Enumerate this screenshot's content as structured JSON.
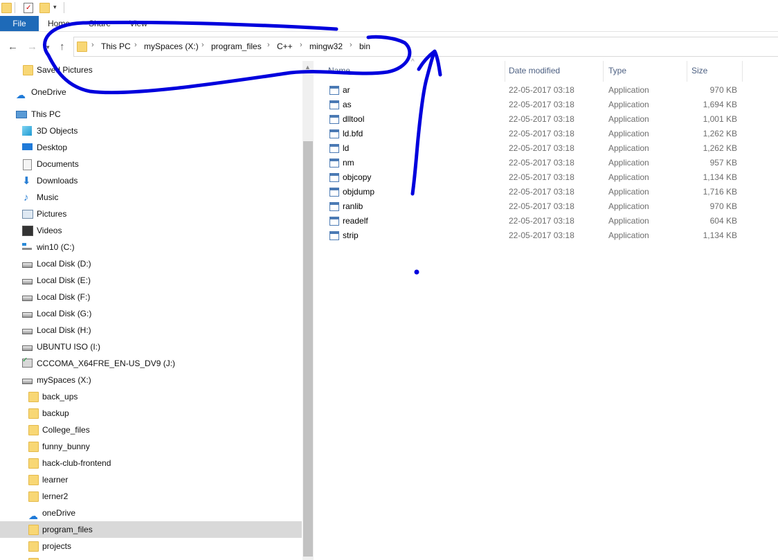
{
  "ribbon": {
    "file": "File",
    "home": "Home",
    "share": "Share",
    "view": "View"
  },
  "address": {
    "crumbs": [
      "This PC",
      "mySpaces (X:)",
      "program_files",
      "C++",
      "mingw32",
      "bin"
    ]
  },
  "nav_pane": {
    "items": [
      {
        "label": "Saved Pictures",
        "icon": "folder-icon"
      },
      {
        "label": "OneDrive",
        "icon": "cloud-icon"
      },
      {
        "label": "This PC",
        "icon": "computer-icon"
      },
      {
        "label": "3D Objects",
        "icon": "cube-icon"
      },
      {
        "label": "Desktop",
        "icon": "desktop-icon"
      },
      {
        "label": "Documents",
        "icon": "documents-icon"
      },
      {
        "label": "Downloads",
        "icon": "download-icon"
      },
      {
        "label": "Music",
        "icon": "music-icon"
      },
      {
        "label": "Pictures",
        "icon": "pictures-icon"
      },
      {
        "label": "Videos",
        "icon": "videos-icon"
      },
      {
        "label": "win10 (C:)",
        "icon": "windows-drive-icon"
      },
      {
        "label": "Local Disk (D:)",
        "icon": "drive-icon"
      },
      {
        "label": "Local Disk (E:)",
        "icon": "drive-icon"
      },
      {
        "label": "Local Disk (F:)",
        "icon": "drive-icon"
      },
      {
        "label": "Local Disk (G:)",
        "icon": "drive-icon"
      },
      {
        "label": "Local Disk (H:)",
        "icon": "drive-icon"
      },
      {
        "label": "UBUNTU ISO (I:)",
        "icon": "drive-icon"
      },
      {
        "label": "CCCOMA_X64FRE_EN-US_DV9 (J:)",
        "icon": "dvd-icon"
      },
      {
        "label": "mySpaces (X:)",
        "icon": "drive-icon"
      },
      {
        "label": "back_ups",
        "icon": "folder-icon"
      },
      {
        "label": "backup",
        "icon": "folder-icon"
      },
      {
        "label": "College_files",
        "icon": "folder-icon"
      },
      {
        "label": "funny_bunny",
        "icon": "folder-icon"
      },
      {
        "label": "hack-club-frontend",
        "icon": "folder-icon"
      },
      {
        "label": "learner",
        "icon": "folder-icon"
      },
      {
        "label": "lerner2",
        "icon": "folder-icon"
      },
      {
        "label": "oneDrive",
        "icon": "cloud-icon"
      },
      {
        "label": "program_files",
        "icon": "folder-icon"
      },
      {
        "label": "projects",
        "icon": "folder-icon"
      }
    ]
  },
  "columns": {
    "name": "Name",
    "date": "Date modified",
    "type": "Type",
    "size": "Size"
  },
  "files": [
    {
      "name": "ar",
      "date": "22-05-2017 03:18",
      "type": "Application",
      "size": "970 KB"
    },
    {
      "name": "as",
      "date": "22-05-2017 03:18",
      "type": "Application",
      "size": "1,694 KB"
    },
    {
      "name": "dlltool",
      "date": "22-05-2017 03:18",
      "type": "Application",
      "size": "1,001 KB"
    },
    {
      "name": "ld.bfd",
      "date": "22-05-2017 03:18",
      "type": "Application",
      "size": "1,262 KB"
    },
    {
      "name": "ld",
      "date": "22-05-2017 03:18",
      "type": "Application",
      "size": "1,262 KB"
    },
    {
      "name": "nm",
      "date": "22-05-2017 03:18",
      "type": "Application",
      "size": "957 KB"
    },
    {
      "name": "objcopy",
      "date": "22-05-2017 03:18",
      "type": "Application",
      "size": "1,134 KB"
    },
    {
      "name": "objdump",
      "date": "22-05-2017 03:18",
      "type": "Application",
      "size": "1,716 KB"
    },
    {
      "name": "ranlib",
      "date": "22-05-2017 03:18",
      "type": "Application",
      "size": "970 KB"
    },
    {
      "name": "readelf",
      "date": "22-05-2017 03:18",
      "type": "Application",
      "size": "604 KB"
    },
    {
      "name": "strip",
      "date": "22-05-2017 03:18",
      "type": "Application",
      "size": "1,134 KB"
    }
  ],
  "colors": {
    "accent": "#1e6ab8",
    "annotation": "#0000dd",
    "selected": "#d9d9d9"
  }
}
